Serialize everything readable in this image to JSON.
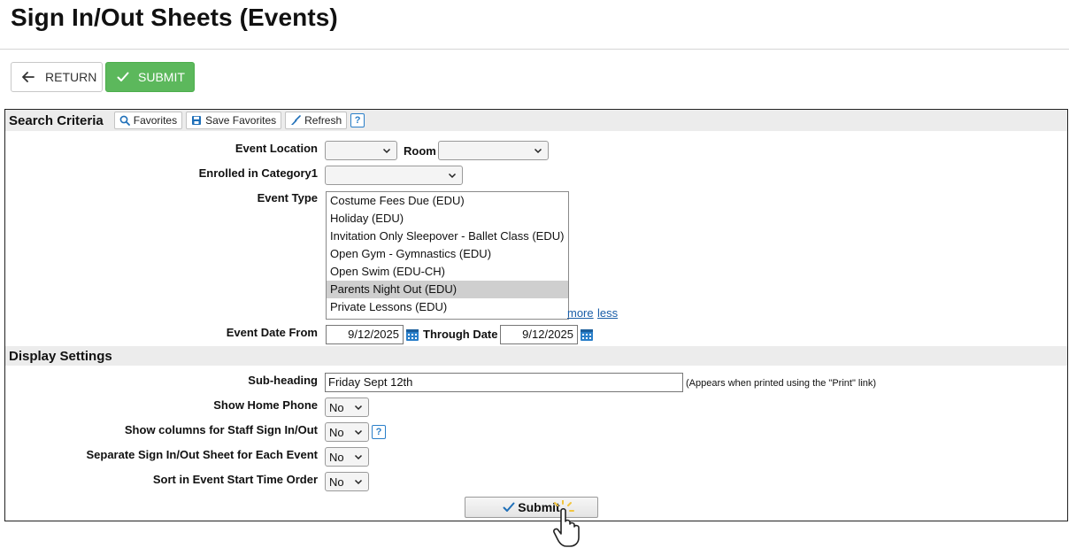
{
  "page": {
    "title": "Sign In/Out Sheets (Events)"
  },
  "toolbar": {
    "return_label": "RETURN",
    "submit_label": "SUBMIT"
  },
  "search": {
    "section_title": "Search Criteria",
    "favorites_label": "Favorites",
    "save_favorites_label": "Save Favorites",
    "refresh_label": "Refresh",
    "help_glyph": "?",
    "event_location_label": "Event Location",
    "event_location_value": "",
    "room_label": "Room",
    "room_value": "",
    "enrolled_label": "Enrolled in Category1",
    "enrolled_value": "",
    "event_type_label": "Event Type",
    "event_types": [
      {
        "label": "Costume Fees Due (EDU)",
        "selected": false
      },
      {
        "label": "Holiday (EDU)",
        "selected": false
      },
      {
        "label": "Invitation Only Sleepover - Ballet Class (EDU)",
        "selected": false
      },
      {
        "label": "Open Gym - Gymnastics (EDU)",
        "selected": false
      },
      {
        "label": "Open Swim (EDU-CH)",
        "selected": false
      },
      {
        "label": "Parents Night Out (EDU)",
        "selected": true
      },
      {
        "label": "Private Lessons (EDU)",
        "selected": false
      }
    ],
    "more_label": "more",
    "less_label": "less",
    "date_from_label": "Event Date From",
    "date_from_value": "9/12/2025",
    "through_label": "Through Date",
    "through_value": "9/12/2025"
  },
  "display": {
    "section_title": "Display Settings",
    "subheading_label": "Sub-heading",
    "subheading_value": "Friday Sept 12th",
    "subheading_hint": "(Appears when printed using the \"Print\" link)",
    "home_phone_label": "Show Home Phone",
    "home_phone_value": "No",
    "staff_label": "Show columns for Staff Sign In/Out",
    "staff_value": "No",
    "separate_label": "Separate Sign In/Out Sheet for Each Event",
    "separate_value": "No",
    "sort_label": "Sort in Event Start Time Order",
    "sort_value": "No",
    "submit_label": "Submit"
  },
  "colors": {
    "submit_green": "#5cb85c",
    "section_bg": "#ececec",
    "link_blue": "#1a5ea8",
    "help_blue": "#2a7fc9"
  }
}
